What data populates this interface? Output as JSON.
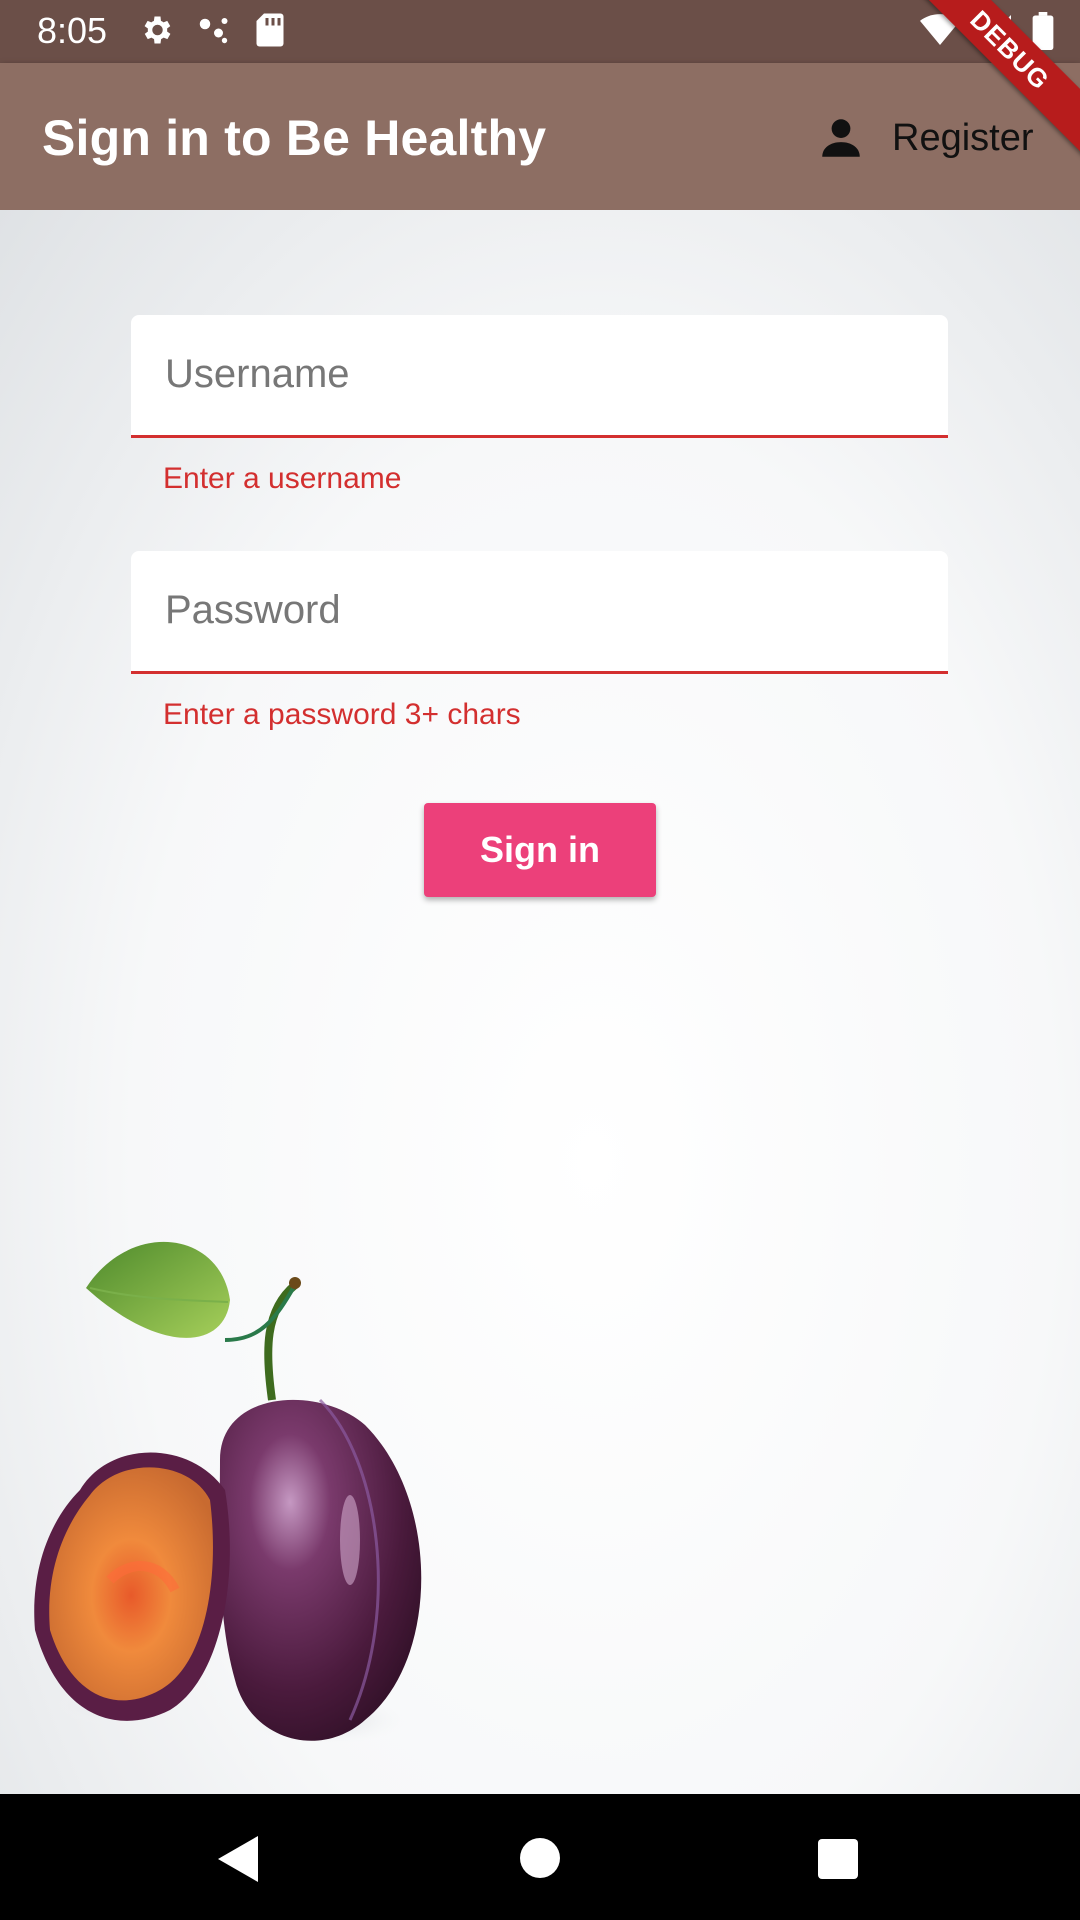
{
  "status_bar": {
    "time": "8:05",
    "left_icons": [
      "settings-icon",
      "notification-dots-icon",
      "sd-card-icon"
    ],
    "right_icons": [
      "wifi-icon",
      "signal-icon",
      "battery-icon"
    ]
  },
  "debug_banner": "DEBUG",
  "app_bar": {
    "title": "Sign in to Be Healthy",
    "register_icon": "person-icon",
    "register_label": "Register",
    "background": "#8d6e63"
  },
  "form": {
    "username": {
      "placeholder": "Username",
      "value": "",
      "error": "Enter a username"
    },
    "password": {
      "placeholder": "Password",
      "value": "",
      "error": "Enter a password 3+ chars"
    },
    "submit_label": "Sign in",
    "error_color": "#d32f2f",
    "button_color": "#ec407a"
  },
  "illustration": "plum-icon",
  "nav_bar": [
    "back-icon",
    "home-icon",
    "recents-icon"
  ]
}
